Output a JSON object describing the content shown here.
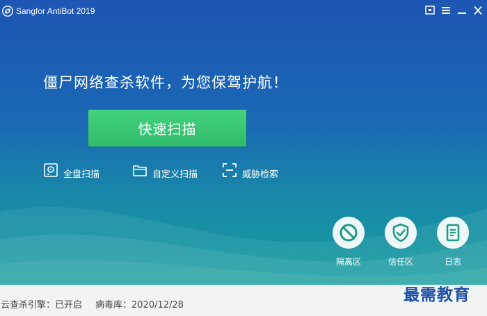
{
  "titlebar": {
    "title": "Sangfor AntiBot 2019",
    "logo_icon": "sangfor-logo-icon",
    "buttons": [
      "feedback-icon",
      "menu-icon",
      "minimize-icon",
      "close-icon"
    ]
  },
  "main": {
    "slogan": "僵尸网络查杀软件，为您保驾护航！",
    "quick_scan_label": "快速扫描",
    "scan_options": [
      {
        "label": "全盘扫描",
        "icon": "full-disk-icon"
      },
      {
        "label": "自定义扫描",
        "icon": "folder-icon"
      },
      {
        "label": "威胁检索",
        "icon": "scan-frame-icon"
      }
    ]
  },
  "tools": [
    {
      "label": "隔离区",
      "icon": "ban-icon"
    },
    {
      "label": "信任区",
      "icon": "shield-check-icon"
    },
    {
      "label": "日志",
      "icon": "document-icon"
    }
  ],
  "statusbar": {
    "engine_status": "云查杀引擎：已开启",
    "virus_db": "病毒库：2020/12/28"
  },
  "watermark": "最需教育",
  "colors": {
    "bg_top": "#1d55b3",
    "bg_bottom": "#14a69a",
    "primary_button": "#37c473",
    "statusbar_bg": "#f2f4f3",
    "icon_color": "#1e9a86",
    "watermark": "#1d4fa8"
  }
}
